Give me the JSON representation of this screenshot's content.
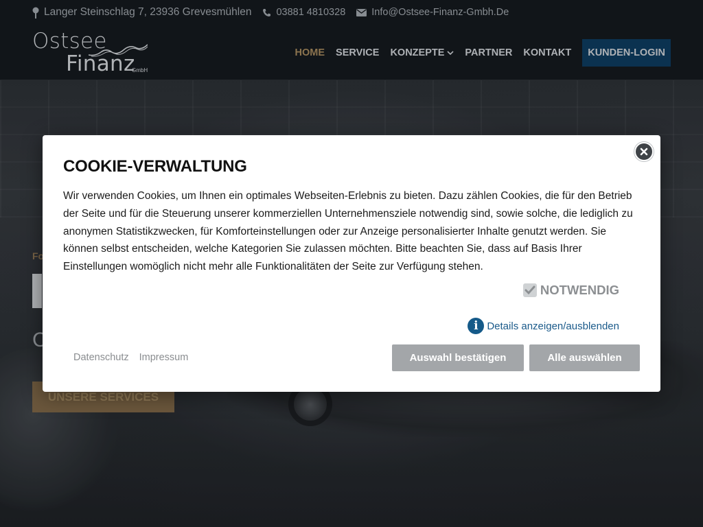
{
  "topbar": {
    "address": "Langer Steinschlag 7, 23936 Grevesmühlen",
    "phone": "03881 4810328",
    "email": "Info@Ostsee-Finanz-Gmbh.De"
  },
  "logo": {
    "line1": "Ostsee",
    "line2": "Finanz",
    "suffix": "GmbH"
  },
  "nav": {
    "items": [
      {
        "label": "HOME",
        "active": true
      },
      {
        "label": "SERVICE",
        "active": false
      },
      {
        "label": "KONZEPTE",
        "active": false,
        "dropdown": true
      },
      {
        "label": "PARTNER",
        "active": false
      },
      {
        "label": "KONTAKT",
        "active": false
      }
    ],
    "login": "KUNDEN-LOGIN"
  },
  "hero": {
    "kicker_fragment": "Fo",
    "subtitle_fragment": "C",
    "services_button": "UNSERE SERVICES"
  },
  "cookie": {
    "title": "COOKIE-VERWALTUNG",
    "text": "Wir verwenden Cookies, um Ihnen ein optimales Webseiten-Erlebnis zu bieten. Dazu zählen Cookies, die für den Betrieb der Seite und für die Steuerung unserer kommerziellen Unternehmensziele notwendig sind, sowie solche, die lediglich zu anonymen Statistikzwecken, für Komforteinstellungen oder zur Anzeige personalisierter Inhalte genutzt werden. Sie können selbst entscheiden, welche Kategorien Sie zulassen möchten. Bitte beachten Sie, dass auf Basis Ihrer Einstellungen womöglich nicht mehr alle Funktionalitäten der Seite zur Verfügung stehen.",
    "necessary_label": "NOTWENDIG",
    "details_label": "Details anzeigen/ausblenden",
    "privacy_link": "Datenschutz",
    "imprint_link": "Impressum",
    "confirm_button": "Auswahl bestätigen",
    "select_all_button": "Alle auswählen"
  },
  "colors": {
    "accent_gold": "#a0855a",
    "login_blue": "#0d3a5c",
    "link_blue": "#1a5a8a",
    "button_gray": "#a3a6a9"
  }
}
